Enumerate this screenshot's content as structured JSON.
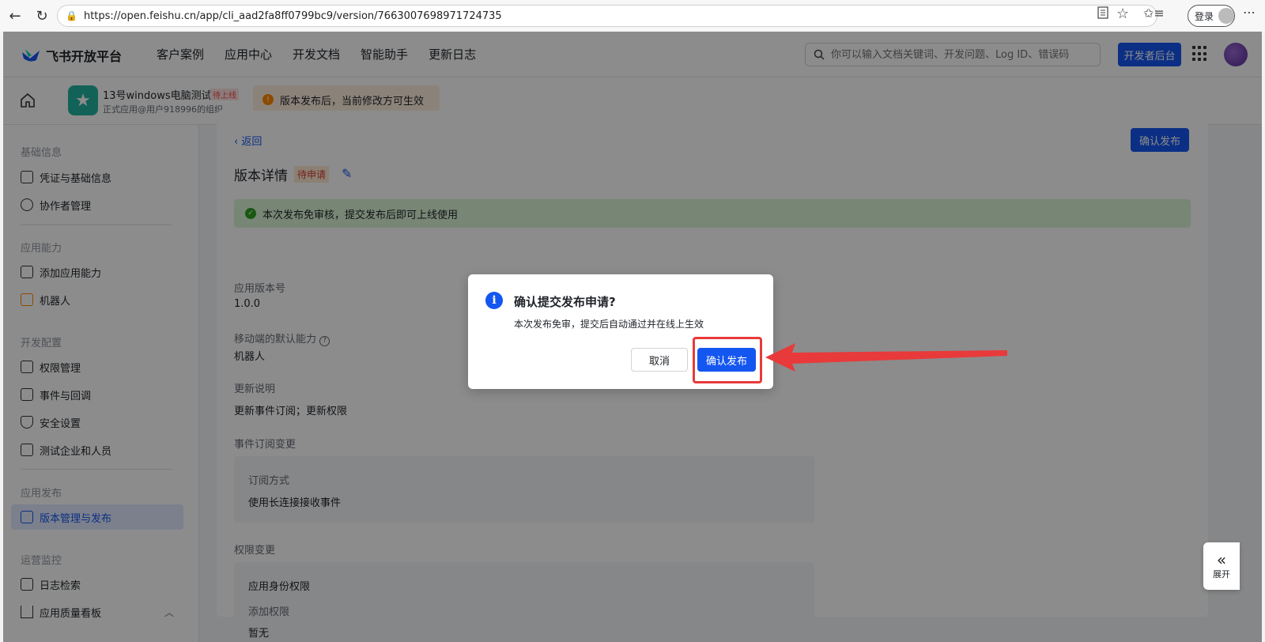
{
  "browser": {
    "url": "https://open.feishu.cn/app/cli_aad2fa8ff0799bc9/version/7663007698971724735",
    "login_label": "登录"
  },
  "topnav": {
    "brand": "飞书开放平台",
    "items": [
      "客户案例",
      "应用中心",
      "开发文档",
      "智能助手",
      "更新日志"
    ],
    "search_placeholder": "你可以输入文档关键词、开发问题、Log ID、错误码",
    "dev_console": "开发者后台"
  },
  "appbar": {
    "app_name": "13号windows电脑测试",
    "app_status": "待上线",
    "app_org": "正式应用@用户918996的组织",
    "notice": "版本发布后，当前修改方可生效"
  },
  "sidebar": {
    "groups": [
      {
        "title": "基础信息",
        "items": [
          "凭证与基础信息",
          "协作者管理"
        ]
      },
      {
        "title": "应用能力",
        "items": [
          "添加应用能力",
          "机器人"
        ]
      },
      {
        "title": "开发配置",
        "items": [
          "权限管理",
          "事件与回调",
          "安全设置",
          "测试企业和人员"
        ]
      },
      {
        "title": "应用发布",
        "items": [
          "版本管理与发布"
        ]
      },
      {
        "title": "运营监控",
        "items": [
          "日志检索",
          "应用质量看板"
        ]
      }
    ]
  },
  "main": {
    "back": "返回",
    "confirm_top": "确认发布",
    "title": "版本详情",
    "status": "待申请",
    "success_msg": "本次发布免审核，提交发布后即可上线使用",
    "version_label": "应用版本号",
    "version_value": "1.0.0",
    "mobile_label": "移动端的默认能力",
    "mobile_value": "机器人",
    "update_label": "更新说明",
    "update_value": "更新事件订阅；更新权限",
    "event_label": "事件订阅变更",
    "event_sub_label": "订阅方式",
    "event_sub_value": "使用长连接接收事件",
    "perm_label": "权限变更",
    "perm_sub_label": "应用身份权限",
    "perm_add_label": "添加权限",
    "perm_cut": "暂无"
  },
  "expand_tab": "展开",
  "modal": {
    "title": "确认提交发布申请?",
    "desc": "本次发布免审，提交后自动通过并在线上生效",
    "cancel": "取消",
    "confirm": "确认发布"
  },
  "colors": {
    "primary": "#1456f0",
    "annotation": "#e83a3a"
  }
}
